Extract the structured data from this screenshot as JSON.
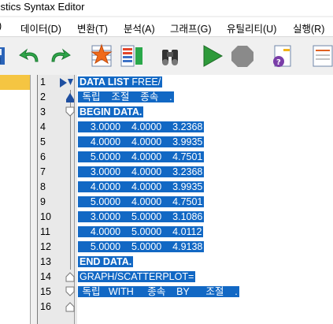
{
  "window": {
    "title": "tistics Syntax Editor"
  },
  "menu": [
    {
      "label": ")"
    },
    {
      "label": "데이터(D)"
    },
    {
      "label": "변환(T)"
    },
    {
      "label": "분석(A)"
    },
    {
      "label": "그래프(G)"
    },
    {
      "label": "유틸리티(U)"
    },
    {
      "label": "실행(R)"
    }
  ],
  "toolbar": [
    {
      "icon": "save-icon"
    },
    {
      "icon": "undo-icon"
    },
    {
      "icon": "redo-icon"
    },
    {
      "icon": "goto-case-icon"
    },
    {
      "icon": "variables-icon"
    },
    {
      "icon": "find-icon"
    },
    {
      "icon": "run-icon"
    },
    {
      "icon": "stop-icon"
    },
    {
      "icon": "syntax-help-icon"
    },
    {
      "icon": "bookmark-icon"
    }
  ],
  "editor": {
    "line_numbers": [
      "1",
      "2",
      "3",
      "4",
      "5",
      "6",
      "7",
      "8",
      "9",
      "10",
      "11",
      "12",
      "13",
      "14",
      "15",
      "16"
    ],
    "lines": [
      {
        "text": "DATA LIST FREE/",
        "bold_prefix": "DATA LIST"
      },
      {
        "text": " 독립    조절    종속    .",
        "bold_prefix": ""
      },
      {
        "text": "BEGIN DATA.",
        "bold_prefix": "BEGIN DATA."
      },
      {
        "text": "    3.0000    4.0000    3.2368",
        "bold_prefix": ""
      },
      {
        "text": "    4.0000    4.0000    3.9935",
        "bold_prefix": ""
      },
      {
        "text": "    5.0000    4.0000    4.7501",
        "bold_prefix": ""
      },
      {
        "text": "    3.0000    4.0000    3.2368",
        "bold_prefix": ""
      },
      {
        "text": "    4.0000    4.0000    3.9935",
        "bold_prefix": ""
      },
      {
        "text": "    5.0000    4.0000    4.7501",
        "bold_prefix": ""
      },
      {
        "text": "    3.0000    5.0000    3.1086",
        "bold_prefix": ""
      },
      {
        "text": "    4.0000    5.0000    4.0112",
        "bold_prefix": ""
      },
      {
        "text": "    5.0000    5.0000    4.9138",
        "bold_prefix": ""
      },
      {
        "text": "END DATA.",
        "bold_prefix": "END DATA."
      },
      {
        "text": "GRAPH/SCATTERPLOT=",
        "bold_prefix": ""
      },
      {
        "text": " 독립   WITH     종속    BY      조절    .",
        "bold_prefix": ""
      },
      {
        "text": "",
        "bold_prefix": ""
      }
    ]
  },
  "colors": {
    "selection": "#1268c4",
    "accent": "#f5c542"
  }
}
